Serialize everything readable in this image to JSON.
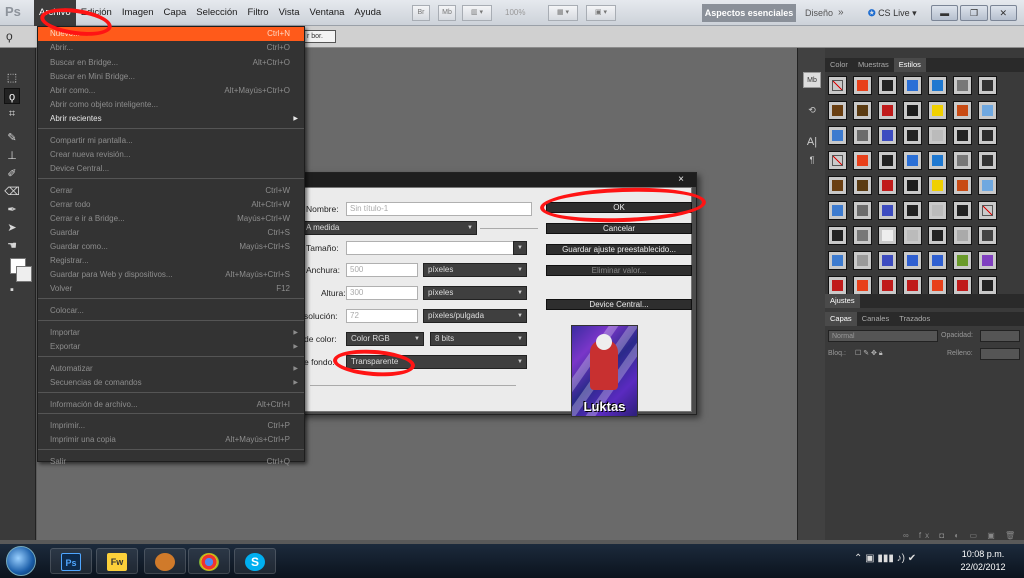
{
  "app": {
    "logo": "Ps"
  },
  "menubar": {
    "menus": [
      "Archivo",
      "Edición",
      "Imagen",
      "Capa",
      "Selección",
      "Filtro",
      "Vista",
      "Ventana",
      "Ayuda"
    ],
    "buttons": [
      "Br",
      "Mb"
    ],
    "zoom": "100%",
    "workspace_active": "Aspectos esenciales",
    "workspace_other": "Diseño",
    "more": "»",
    "cslive": "CS Live"
  },
  "optionsbar": {
    "hint": "r bor."
  },
  "file_menu": {
    "items": [
      {
        "label": "Nuevo...",
        "shortcut": "Ctrl+N",
        "enabled": true,
        "highlight": true
      },
      {
        "label": "Abrir...",
        "shortcut": "Ctrl+O",
        "enabled": false
      },
      {
        "label": "Buscar en Bridge...",
        "shortcut": "Alt+Ctrl+O",
        "enabled": false
      },
      {
        "label": "Buscar en Mini Bridge...",
        "shortcut": "",
        "enabled": false
      },
      {
        "label": "Abrir como...",
        "shortcut": "Alt+Mayús+Ctrl+O",
        "enabled": false
      },
      {
        "label": "Abrir como objeto inteligente...",
        "shortcut": "",
        "enabled": false
      },
      {
        "label": "Abrir recientes",
        "shortcut": "",
        "enabled": true,
        "submenu": true
      },
      {
        "label": "Compartir mi pantalla...",
        "shortcut": "",
        "enabled": false
      },
      {
        "label": "Crear nueva revisión...",
        "shortcut": "",
        "enabled": false
      },
      {
        "label": "Device Central...",
        "shortcut": "",
        "enabled": false
      },
      {
        "label": "Cerrar",
        "shortcut": "Ctrl+W",
        "enabled": false
      },
      {
        "label": "Cerrar todo",
        "shortcut": "Alt+Ctrl+W",
        "enabled": false
      },
      {
        "label": "Cerrar e ir a Bridge...",
        "shortcut": "Mayús+Ctrl+W",
        "enabled": false
      },
      {
        "label": "Guardar",
        "shortcut": "Ctrl+S",
        "enabled": false
      },
      {
        "label": "Guardar como...",
        "shortcut": "Mayús+Ctrl+S",
        "enabled": false
      },
      {
        "label": "Registrar...",
        "shortcut": "",
        "enabled": false
      },
      {
        "label": "Guardar para Web y dispositivos...",
        "shortcut": "Alt+Mayús+Ctrl+S",
        "enabled": false
      },
      {
        "label": "Volver",
        "shortcut": "F12",
        "enabled": false
      },
      {
        "label": "Colocar...",
        "shortcut": "",
        "enabled": false
      },
      {
        "label": "Importar",
        "shortcut": "",
        "enabled": false,
        "submenu": true
      },
      {
        "label": "Exportar",
        "shortcut": "",
        "enabled": false,
        "submenu": true
      },
      {
        "label": "Automatizar",
        "shortcut": "",
        "enabled": false,
        "submenu": true
      },
      {
        "label": "Secuencias de comandos",
        "shortcut": "",
        "enabled": false,
        "submenu": true
      },
      {
        "label": "Información de archivo...",
        "shortcut": "Alt+Ctrl+I",
        "enabled": false
      },
      {
        "label": "Imprimir...",
        "shortcut": "Ctrl+P",
        "enabled": false
      },
      {
        "label": "Imprimir una copia",
        "shortcut": "Alt+Mayús+Ctrl+P",
        "enabled": false
      },
      {
        "label": "Salir",
        "shortcut": "Ctrl+Q",
        "enabled": false
      }
    ]
  },
  "dialog": {
    "close": "×",
    "name_label": "Nombre:",
    "name_value": "Sin título-1",
    "preset_value": "A medida",
    "size_label": "Tamaño:",
    "width_label": "Anchura:",
    "width_value": "500",
    "width_unit": "píxeles",
    "height_label": "Altura:",
    "height_value": "300",
    "height_unit": "píxeles",
    "res_label": "solución:",
    "res_value": "72",
    "res_unit": "píxeles/pulgada",
    "color_label": "de color:",
    "color_mode": "Color RGB",
    "color_bits": "8 bits",
    "bg_label": "e fondo:",
    "bg_value": "Transparente",
    "ok": "OK",
    "cancel": "Cancelar",
    "save_preset": "Guardar ajuste preestablecido...",
    "delete_preset": "Eliminar valor...",
    "device_central": "Device Central...",
    "preview_caption": "Luktas"
  },
  "panels": {
    "top_tabs": [
      "Color",
      "Muestras",
      "Estilos"
    ],
    "adjust_tab": "Ajustes",
    "layer_tabs": [
      "Capas",
      "Canales",
      "Trazados"
    ],
    "blend_mode": "Normal",
    "opacity_label": "Opacidad:",
    "lock_label": "Bloq.:",
    "fill_label": "Relleno:"
  },
  "taskbar": {
    "apps": [
      "Ps",
      "Fw",
      "",
      "",
      "S"
    ],
    "time": "10:08 p.m.",
    "date": "22/02/2012"
  },
  "colors": {
    "highlight": "#ff5a1a",
    "annotation": "#ff1414",
    "workspace": "#8a9099"
  }
}
